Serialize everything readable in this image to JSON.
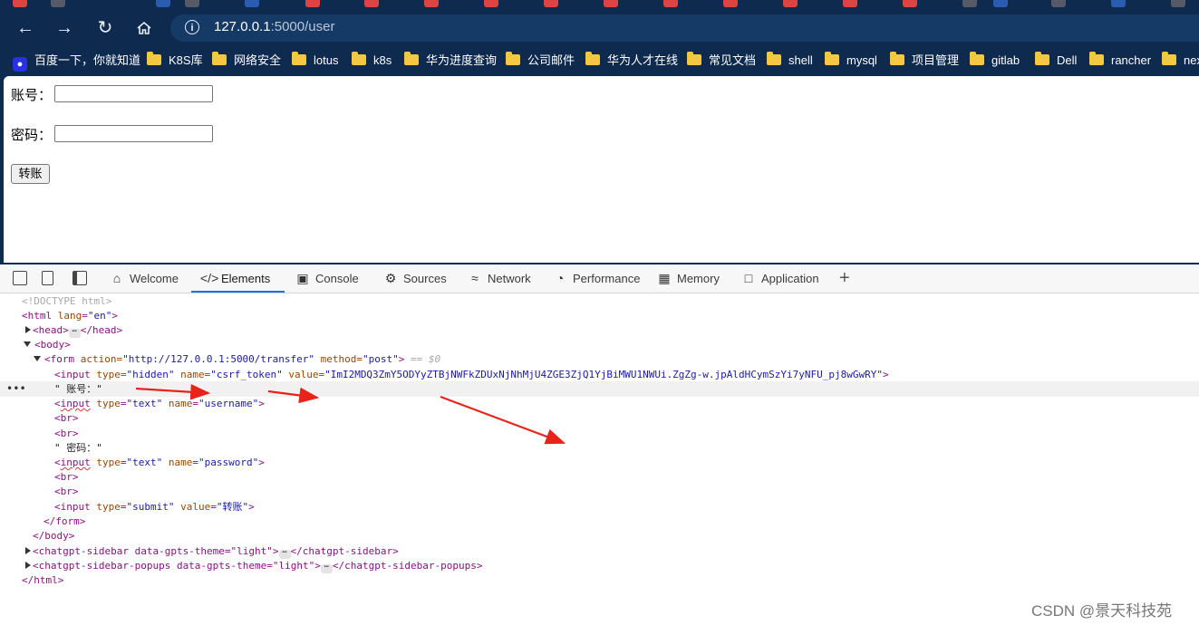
{
  "browser": {
    "url_host": "127.0.0.1",
    "url_rest": ":5000/user",
    "bookmarks": [
      "百度一下，你就知道",
      "K8S库",
      "网络安全",
      "lotus",
      "k8s",
      "华为进度查询",
      "公司邮件",
      "华为人才在线",
      "常见文档",
      "shell",
      "mysql",
      "项目管理",
      "gitlab",
      "Dell",
      "rancher",
      "nex"
    ]
  },
  "page": {
    "username_label": "账号：",
    "password_label": "密码：",
    "submit_label": "转账"
  },
  "devtools": {
    "tabs": [
      "Welcome",
      "Elements",
      "Console",
      "Sources",
      "Network",
      "Performance",
      "Memory",
      "Application"
    ],
    "active_tab": "Elements",
    "dom": {
      "doctype": "<!DOCTYPE html>",
      "html_open": "<html lang=\"en\">",
      "head": "<head>",
      "head_close": "</head>",
      "body_open": "<body>",
      "form_tag": "<form",
      "form_action_attr": " action=",
      "form_action_val": "\"http://127.0.0.1:5000/transfer\"",
      "form_method_attr": " method=",
      "form_method_val": "\"post\"",
      "form_close_bracket": ">",
      "selected_marker": " == $0",
      "csrf_line_tag": "<input",
      "csrf_type_attr": " type=",
      "csrf_type_val": "\"hidden\"",
      "csrf_name_attr": " name=",
      "csrf_name_val": "\"csrf_token\"",
      "csrf_value_attr": " value=",
      "csrf_value_val": "\"ImI2MDQ3ZmY5ODYyZTBjNWFkZDUxNjNhMjU4ZGE3ZjQ1YjBiMWU1NWUi.ZgZg-w.jpAldHCymSzYi7yNFU_pj8wGwRY\"",
      "text_username": "\" 账号：\"",
      "input_username_type": "\"text\"",
      "input_username_name": "\"username\"",
      "br": "<br>",
      "text_password": "\" 密码：\"",
      "input_password_type": "\"text\"",
      "input_password_name": "\"password\"",
      "input_submit_type": "\"submit\"",
      "input_submit_value": "\"转账\"",
      "form_close": "</form>",
      "body_close": "</body>",
      "sidebar_open": "<chatgpt-sidebar data-gpts-theme=\"light\">",
      "sidebar_close": "</chatgpt-sidebar>",
      "popups_open": "<chatgpt-sidebar-popups data-gpts-theme=\"light\">",
      "popups_close": "</chatgpt-sidebar-popups>",
      "html_close": "</html>"
    }
  },
  "watermark": "CSDN @景天科技苑",
  "colors": {
    "chrome_bg": "#0f2a4f",
    "annotation_arrow": "#e8231a",
    "active_tab_underline": "#1a73e8"
  }
}
